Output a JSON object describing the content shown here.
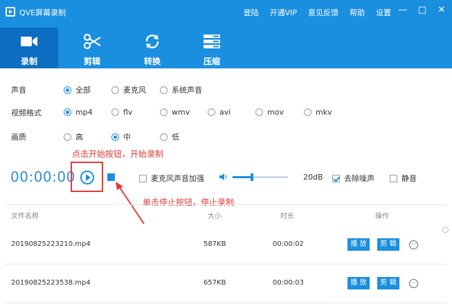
{
  "window": {
    "title": "QVE屏幕录制",
    "links": [
      "登陆",
      "开通VIP",
      "意见反馈",
      "帮助",
      "设置"
    ],
    "controls": [
      "—",
      "□",
      "✕"
    ]
  },
  "tabs": [
    {
      "label": "录制",
      "icon": "video-camera-icon",
      "active": true
    },
    {
      "label": "剪辑",
      "icon": "scissors-icon",
      "active": false
    },
    {
      "label": "转换",
      "icon": "convert-icon",
      "active": false
    },
    {
      "label": "压缩",
      "icon": "compress-icon",
      "active": false
    }
  ],
  "settings": {
    "audio": {
      "label": "声音",
      "options": [
        "全部",
        "麦克风",
        "系统声音"
      ],
      "selected": "全部"
    },
    "format": {
      "label": "视频格式",
      "options": [
        "mp4",
        "flv",
        "wmv",
        "avi",
        "mov",
        "mkv"
      ],
      "selected": "mp4"
    },
    "quality": {
      "label": "画质",
      "options": [
        "高",
        "中",
        "低"
      ],
      "selected": "中"
    }
  },
  "recorder": {
    "timer": "00:00:00",
    "mic_boost_label": "麦克风声音加强",
    "mic_boost_checked": false,
    "gain_value": "20dB",
    "gain_level": 0.35,
    "denoise_label": "去除噪声",
    "denoise_checked": true,
    "mute_label": "静音",
    "mute_checked": false
  },
  "annotations": {
    "start_hint": "点击开始按钮，开始录制",
    "stop_hint": "单击停止按钮，停止录制",
    "accent": "#e53935"
  },
  "table": {
    "headers": {
      "name": "文件名称",
      "size": "大小",
      "duration": "时长",
      "actions": "操作"
    },
    "rows": [
      {
        "name": "20190825223210.mp4",
        "size": "587KB",
        "duration": "00:00:02"
      },
      {
        "name": "20190825223538.mp4",
        "size": "657KB",
        "duration": "00:00:03"
      }
    ],
    "play_label": "播 放",
    "edit_label": "剪 辑",
    "more_label": "···"
  },
  "colors": {
    "brand": "#1a8fe0",
    "brand_dark": "#0b6ec0"
  }
}
